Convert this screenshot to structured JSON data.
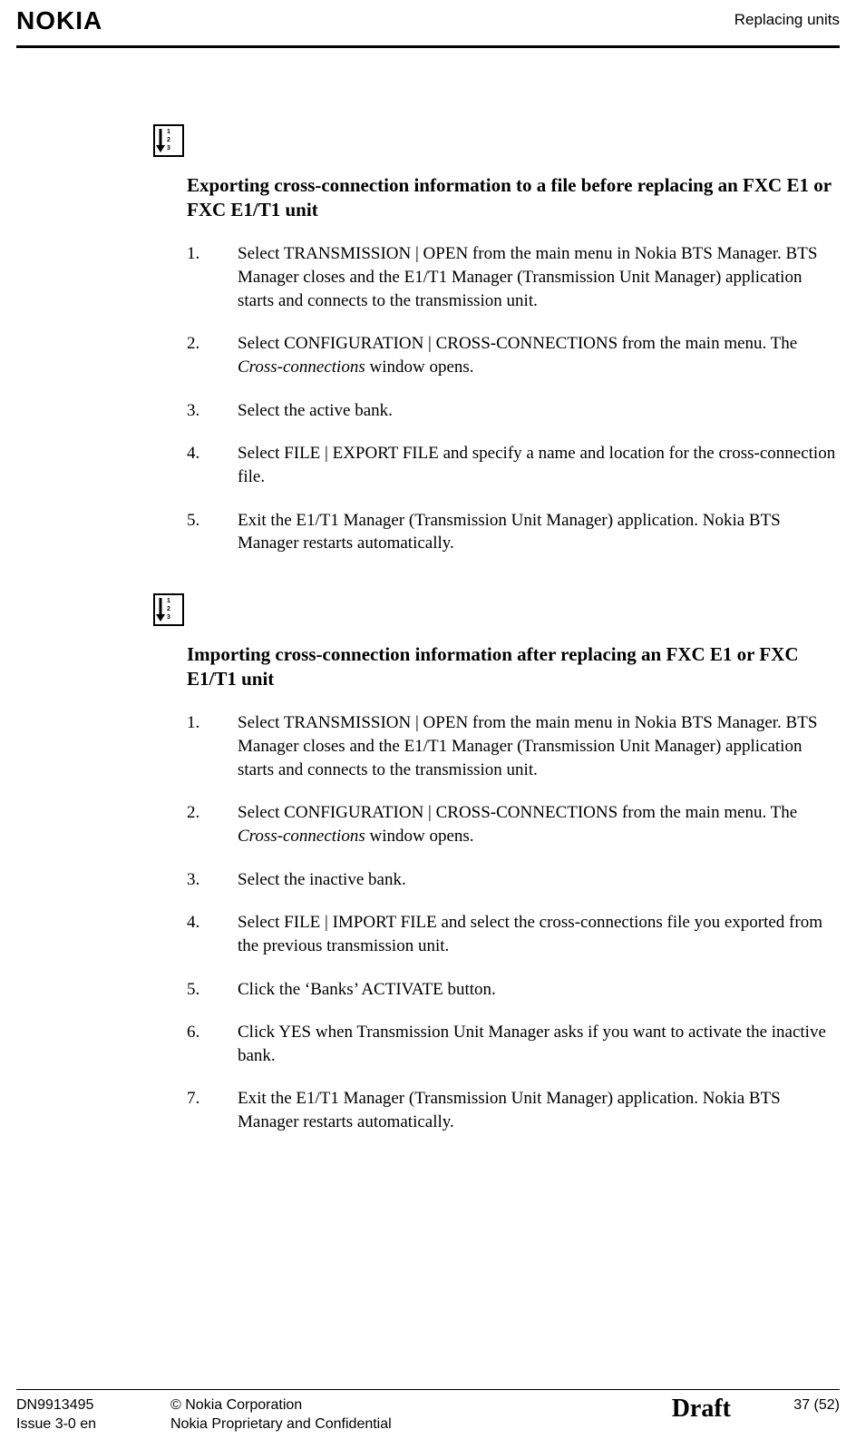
{
  "header": {
    "logo": "NOKIA",
    "right": "Replacing units"
  },
  "sections": [
    {
      "icon": {
        "nums": [
          "1",
          "2",
          "3"
        ]
      },
      "title": "Exporting cross-connection information to a file before replacing an FXC E1 or FXC E1/T1 unit",
      "steps": [
        {
          "n": "1.",
          "text": "Select TRANSMISSION | OPEN from the main menu in Nokia BTS Manager. BTS Manager closes and the E1/T1 Manager (Transmission Unit Manager) application starts and connects to the transmission unit."
        },
        {
          "n": "2.",
          "text_pre": "Select CONFIGURATION | CROSS-CONNECTIONS from the main menu. The ",
          "italic": "Cross-connections",
          "text_post": " window opens."
        },
        {
          "n": "3.",
          "text": "Select the active bank."
        },
        {
          "n": "4.",
          "text": "Select FILE | EXPORT FILE and specify a name and location for the cross-connection file."
        },
        {
          "n": "5.",
          "text": "Exit the E1/T1 Manager (Transmission Unit Manager) application. Nokia BTS Manager restarts automatically."
        }
      ]
    },
    {
      "icon": {
        "nums": [
          "1",
          "2",
          "3"
        ]
      },
      "title": "Importing cross-connection information after replacing an FXC E1 or FXC E1/T1 unit",
      "steps": [
        {
          "n": "1.",
          "text": "Select TRANSMISSION | OPEN from the main menu in Nokia BTS Manager. BTS Manager closes and the E1/T1 Manager (Transmission Unit Manager) application starts and connects to the transmission unit."
        },
        {
          "n": "2.",
          "text_pre": "Select CONFIGURATION | CROSS-CONNECTIONS from the main menu. The ",
          "italic": "Cross-connections",
          "text_post": " window opens."
        },
        {
          "n": "3.",
          "text": "Select the inactive bank."
        },
        {
          "n": "4.",
          "text": "Select FILE | IMPORT FILE and select the cross-connections file you exported from the previous transmission unit."
        },
        {
          "n": "5.",
          "text": "Click the ‘Banks’ ACTIVATE button."
        },
        {
          "n": "6.",
          "text": "Click YES when Transmission Unit Manager asks if you want to activate the inactive bank."
        },
        {
          "n": "7.",
          "text": "Exit the E1/T1 Manager (Transmission Unit Manager) application. Nokia BTS Manager restarts automatically."
        }
      ]
    }
  ],
  "footer": {
    "left1": "DN9913495",
    "left2": "Issue 3-0 en",
    "center1": "© Nokia Corporation",
    "center2": "Nokia Proprietary and Confidential",
    "draft": "Draft",
    "right": "37 (52)"
  }
}
